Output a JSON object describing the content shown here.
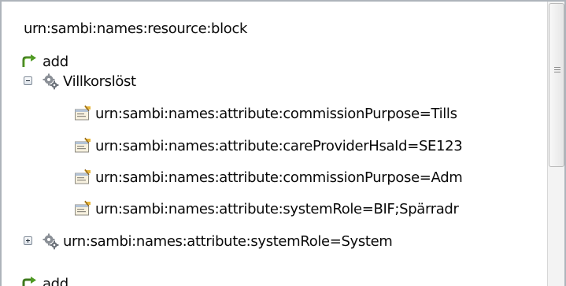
{
  "tree": {
    "header": "urn:sambi:names:resource:block",
    "add": "add",
    "group": "Villkorslöst",
    "attributes": [
      "urn:sambi:names:attribute:commissionPurpose=Tills",
      "urn:sambi:names:attribute:careProviderHsaId=SE123",
      "urn:sambi:names:attribute:commissionPurpose=Adm",
      "urn:sambi:names:attribute:systemRole=BIF;Spärradr"
    ],
    "collapsed_group": "urn:sambi:names:attribute:systemRole=System",
    "partial_row": "add"
  },
  "icons": {
    "add": "add-icon",
    "group": "gears-icon",
    "attribute": "attribute-icon",
    "expand": "expand-icon",
    "collapse": "collapse-icon"
  },
  "colors": {
    "border": "#aeb4bb",
    "text": "#0a0a0a",
    "scrollbar": "#f3f3f3"
  }
}
